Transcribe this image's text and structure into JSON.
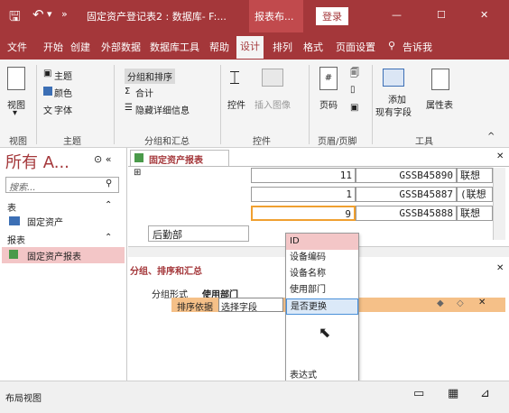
{
  "titlebar": {
    "save_icon": "save-icon",
    "undo_icon": "undo-icon",
    "more": "»",
    "doc_title": "固定资产登记表2 : 数据库- F:...",
    "context_tab": "报表布...",
    "login": "登录",
    "minimize": "—",
    "maximize": "☐",
    "close": "✕"
  },
  "tabs": [
    "文件",
    "开始",
    "创建",
    "外部数据",
    "数据库工具",
    "帮助",
    "设计",
    "排列",
    "格式",
    "页面设置",
    "告诉我"
  ],
  "ribbon": {
    "view_btn": "视图",
    "theme_btn": "主题",
    "color_btn": "颜色",
    "font_btn": "字体",
    "group_sort_btn": "分组和排序",
    "total_btn": "合计",
    "hide_details_btn": "隐藏详细信息",
    "controls_btn": "控件",
    "insert_image_btn": "插入图像",
    "page_no_btn": "页码",
    "add_fields_btn": "添加\n现有字段",
    "add_fields_l1": "添加",
    "add_fields_l2": "现有字段",
    "property_sheet_btn": "属性表",
    "groups": [
      "视图",
      "主题",
      "分组和汇总",
      "控件",
      "页眉/页脚",
      "工具"
    ]
  },
  "nav": {
    "title": "所有 A...",
    "search_placeholder": "搜索...",
    "sections": [
      {
        "name": "表",
        "items": [
          "固定资产"
        ]
      },
      {
        "name": "报表",
        "items": [
          "固定资产报表"
        ]
      }
    ]
  },
  "doc": {
    "tab_title": "固定资产报表",
    "rows": [
      {
        "num": "11",
        "code": "GSSB45890",
        "name": "联想"
      },
      {
        "num": "1",
        "code": "GSSB45887",
        "name": "(联想"
      },
      {
        "num": "9",
        "code": "GSSB45888",
        "name": "联想"
      }
    ],
    "footer_section": "后勤部",
    "group_pane_title": "分组、排序和汇总",
    "group_form_label": "分组形式",
    "group_form_value": "使用部门",
    "sort_by_label": "排序依据",
    "select_field": "选择字段",
    "dropdown_items": [
      "ID",
      "设备编码",
      "设备名称",
      "使用部门",
      "是否更换"
    ],
    "dropdown_selected_index": 4,
    "expression": "表达式"
  },
  "status": {
    "view_name": "布局视图"
  }
}
